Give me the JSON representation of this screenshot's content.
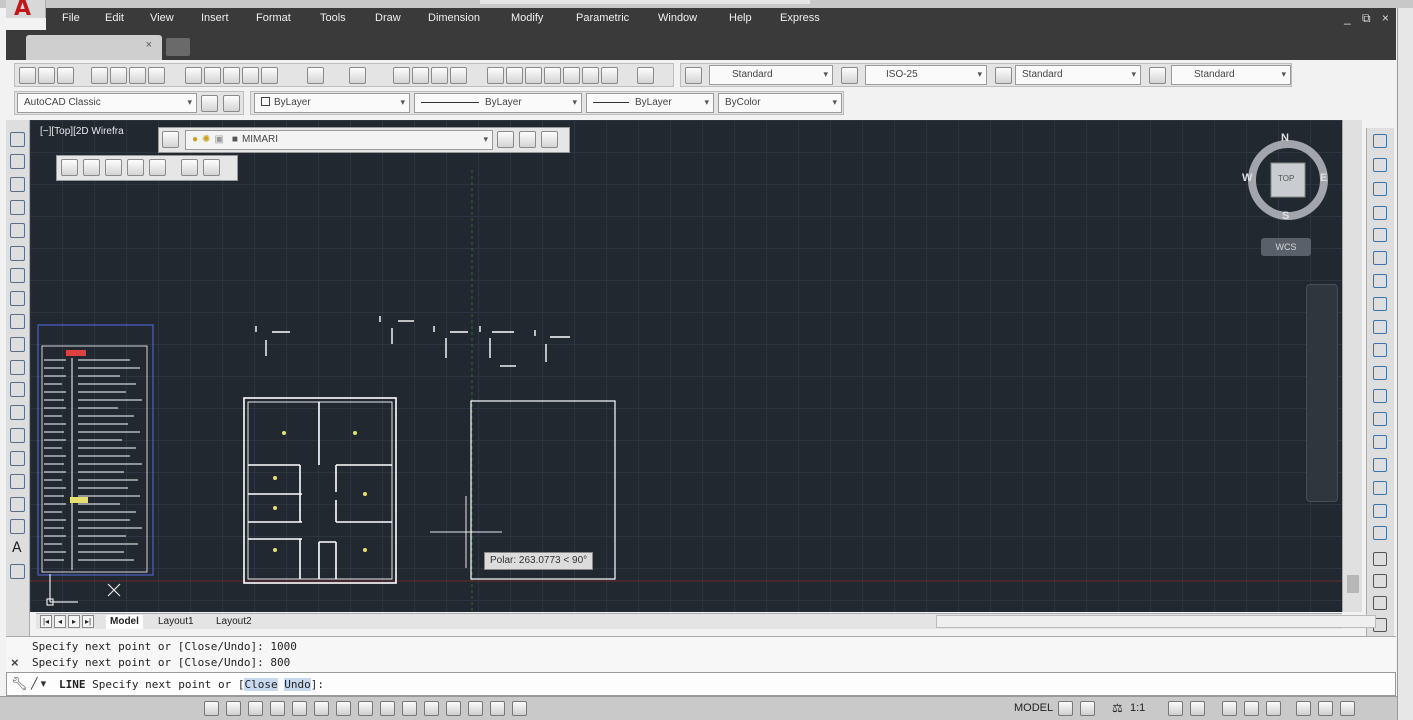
{
  "menu": [
    "File",
    "Edit",
    "View",
    "Insert",
    "Format",
    "Tools",
    "Draw",
    "Dimension",
    "Modify",
    "Parametric",
    "Window",
    "Help",
    "Express"
  ],
  "window_controls": "_ ⧉ ×",
  "doc_tab": {
    "close": "×"
  },
  "styles": {
    "text_style": "Standard",
    "dim_style": "ISO-25",
    "table_style": "Standard",
    "mleader_style": "Standard"
  },
  "workspace": "AutoCAD Classic",
  "properties": {
    "layer": "ByLayer",
    "linetype": "ByLayer",
    "lineweight": "ByLayer",
    "color": "ByColor"
  },
  "viewport": {
    "label": "[−][Top][2D Wirefra",
    "current_layer": "MIMARI"
  },
  "viewcube": {
    "north": "N",
    "south": "S",
    "east": "E",
    "west": "W",
    "face": "TOP",
    "wcs": "WCS"
  },
  "polar_tooltip": "Polar: 263.0773 < 90°",
  "layout_tabs": [
    "Model",
    "Layout1",
    "Layout2"
  ],
  "command": {
    "history": [
      "Specify next point or [Close/Undo]: 1000",
      "Specify next point or [Close/Undo]: 800"
    ],
    "prompt_icon": "╱ ▾",
    "prompt_cmd": "LINE",
    "prompt_text": "Specify next point or [",
    "opt_close": "Close",
    "opt_undo": "Undo",
    "prompt_end": "]:"
  },
  "status": {
    "model": "MODEL",
    "scale": "1:1"
  },
  "colors": {
    "viewport_bg": "#212830",
    "grid": "#2c3540",
    "menubar": "#3a3a3a",
    "accent": "#c0171a"
  }
}
